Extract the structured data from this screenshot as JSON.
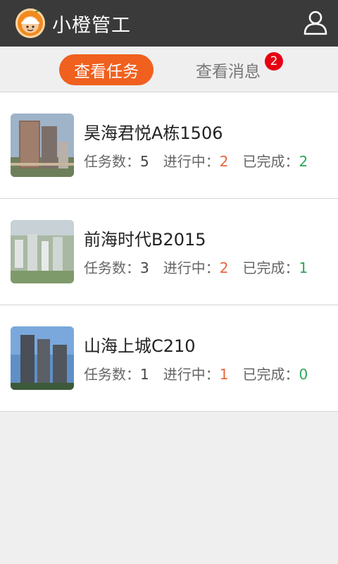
{
  "header": {
    "app_title": "小橙管工",
    "logo_icon": "worker-helmet-logo-icon",
    "user_icon": "user-icon"
  },
  "tabs": {
    "active_label": "查看任务",
    "inactive_label": "查看消息",
    "message_badge": "2"
  },
  "stat_labels": {
    "total": "任务数：",
    "in_progress": "进行中：",
    "done": "已完成："
  },
  "projects": [
    {
      "name": "昊海君悦A栋1506",
      "total": "5",
      "in_progress": "2",
      "done": "2"
    },
    {
      "name": "前海时代B2015",
      "total": "3",
      "in_progress": "2",
      "done": "1"
    },
    {
      "name": "山海上城C210",
      "total": "1",
      "in_progress": "1",
      "done": "0"
    }
  ],
  "colors": {
    "header_bg": "#3a3a3a",
    "accent": "#f0601e",
    "badge": "#e60012",
    "in_progress": "#e8663a",
    "done": "#2ca657"
  }
}
